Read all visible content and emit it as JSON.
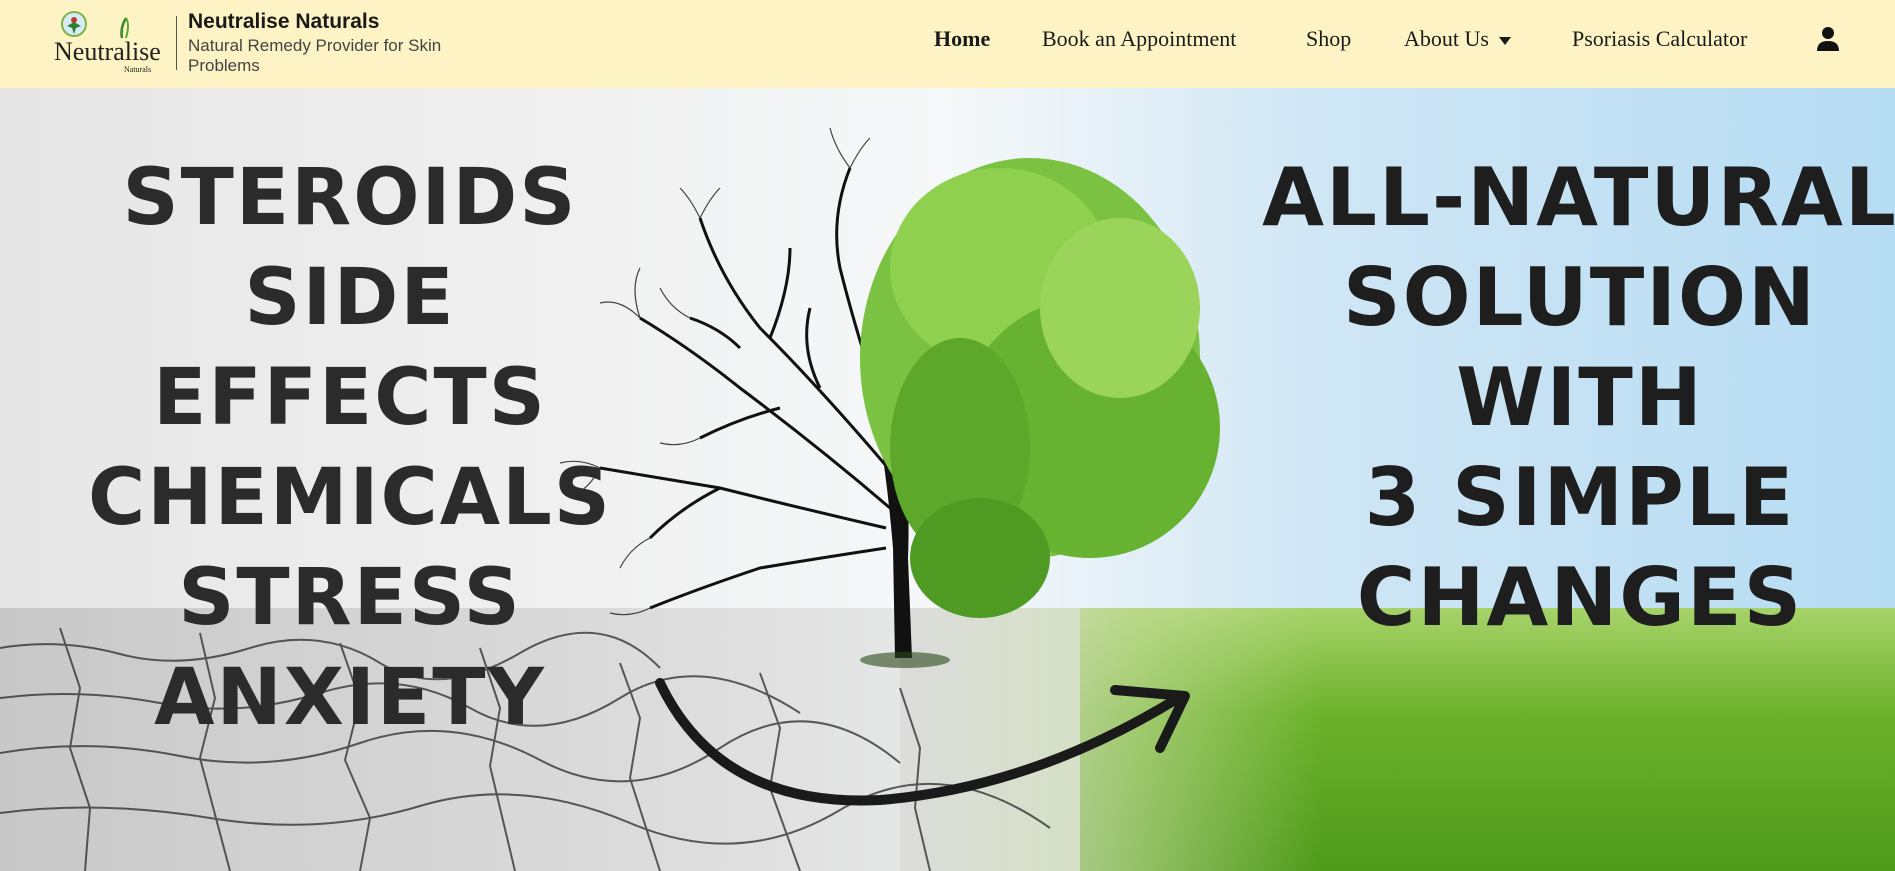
{
  "header": {
    "brand_name": "Neutralise Naturals",
    "tagline": "Natural Remedy Provider for Skin Problems",
    "logo_text": "Neutralise",
    "logo_subtext": "Naturals"
  },
  "nav": {
    "items": [
      {
        "label": "Home",
        "active": true
      },
      {
        "label": "Book an Appointment",
        "active": false
      },
      {
        "label": "Shop",
        "active": false
      },
      {
        "label": "About Us",
        "active": false,
        "dropdown": true
      },
      {
        "label": "Psoriasis Calculator",
        "active": false
      }
    ],
    "user_icon": "user-icon"
  },
  "hero": {
    "left_words": [
      "STEROIDS",
      "SIDE EFFECTS",
      "CHEMICALS",
      "STRESS",
      "ANXIETY"
    ],
    "right_words": [
      "ALL-NATURAL",
      "SOLUTION",
      "WITH",
      "3 SIMPLE",
      "CHANGES"
    ]
  },
  "colors": {
    "header_bg": "#fdf3c4",
    "text_dark": "#2b2b2b",
    "leaf_green": "#6db22c"
  }
}
